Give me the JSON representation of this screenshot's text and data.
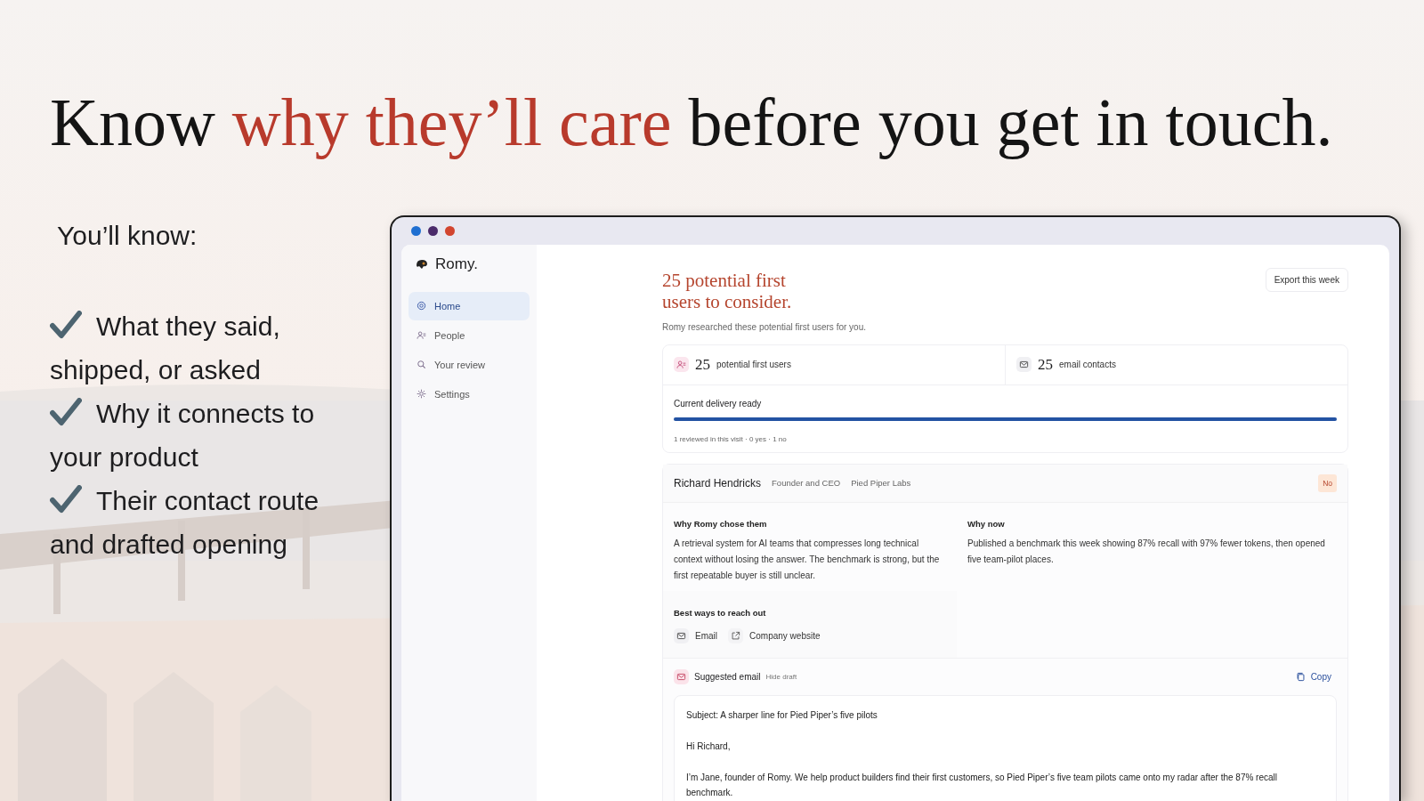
{
  "headline": [
    {
      "text": "Know ",
      "accent": false
    },
    {
      "text": "why they’ll care",
      "accent": true
    },
    {
      "text": " before you get in touch.",
      "accent": false
    }
  ],
  "benefits": {
    "title": "You’ll know:",
    "items": [
      "What they said, shipped, or asked",
      "Why it connects to your product",
      "Their contact route and drafted opening"
    ]
  },
  "window": {
    "dots": [
      {
        "color": "#1f6fd1"
      },
      {
        "color": "#4a2a6a"
      },
      {
        "color": "#d2452f"
      }
    ]
  },
  "sidebar": {
    "brand": "Romy.",
    "items": [
      {
        "label": "Home",
        "selected": true
      },
      {
        "label": "People",
        "selected": false
      },
      {
        "label": "Your review",
        "selected": false
      },
      {
        "label": "Settings",
        "selected": false
      }
    ]
  },
  "main": {
    "title": "25 potential first users to consider.",
    "subtitle": "Romy researched these potential first users for you.",
    "export_button": "Export this week",
    "stats": [
      {
        "value": "25",
        "label": "potential first users"
      },
      {
        "value": "25",
        "label": "email contacts"
      }
    ],
    "delivery": {
      "label": "Current delivery ready",
      "level": 1.0,
      "note": "1 reviewed in this visit · 0 yes · 1 no"
    },
    "person": {
      "name": "Richard Hendricks",
      "role": "Founder and CEO",
      "company": "Pied Piper Labs",
      "verdict": "No",
      "why_chosen": {
        "title": "Why Romy chose them",
        "text": "A retrieval system for AI teams that compresses long technical context without losing the answer. The benchmark is strong, but the first repeatable buyer is still unclear."
      },
      "why_now": {
        "title": "Why now",
        "text": "Published a benchmark this week showing 87% recall with 97% fewer tokens, then opened five team-pilot places."
      },
      "reach": {
        "title": "Best ways to reach out",
        "channels": [
          {
            "kind": "email",
            "label": "Email"
          },
          {
            "kind": "website",
            "label": "Company website"
          }
        ]
      }
    },
    "email": {
      "title": "Suggested email",
      "toggle": "Hide draft",
      "copy": "Copy",
      "lines": [
        "Subject: A sharper line for Pied Piper’s five pilots",
        "Hi Richard,",
        "I’m Jane, founder of Romy. We help product builders find their first customers, so Pied Piper’s five team pilots came onto my radar after the 87% recall benchmark."
      ]
    }
  }
}
